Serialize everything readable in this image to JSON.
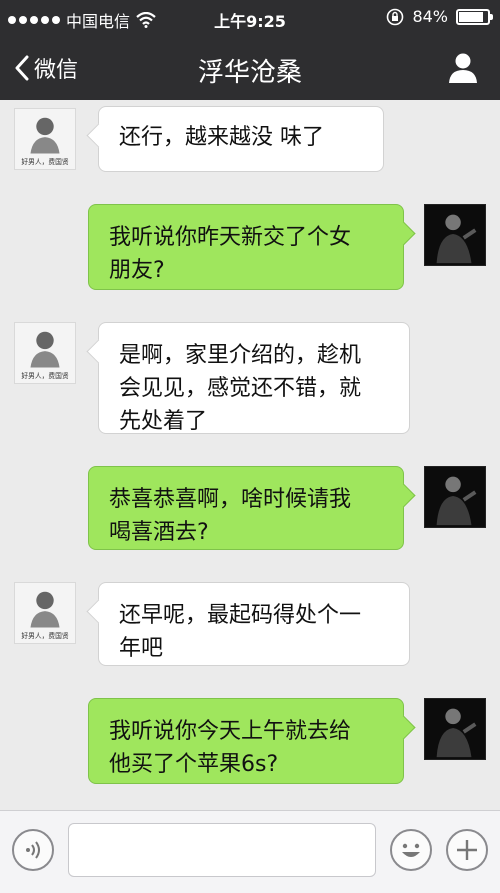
{
  "status_bar": {
    "carrier": "中国电信",
    "time": "上午9:25",
    "battery_text": "84%",
    "battery_level": 0.84
  },
  "nav": {
    "back_label": "微信",
    "title": "浮华沧桑"
  },
  "avatar_caption": "好男人，费国贤",
  "messages": [
    {
      "from": "friend",
      "lines": [
        "还行，越来越没 味了"
      ]
    },
    {
      "from": "me",
      "lines": [
        "我听说你昨天新交了个女",
        "朋友?"
      ]
    },
    {
      "from": "friend",
      "lines": [
        "是啊，家里介绍的，趁机",
        "会见见，感觉还不错，就",
        "先处着了"
      ]
    },
    {
      "from": "me",
      "lines": [
        "恭喜恭喜啊，啥时候请我",
        "喝喜酒去?"
      ]
    },
    {
      "from": "friend",
      "lines": [
        "还早呢，最起码得处个一",
        "年吧"
      ]
    },
    {
      "from": "me",
      "lines": [
        "我听说你今天上午就去给",
        "他买了个苹果6s?"
      ]
    }
  ],
  "icons": {
    "back": "chevron-left-icon",
    "profile": "person-icon",
    "voice": "voice-icon",
    "emoji": "smiley-icon",
    "add": "plus-icon",
    "signal": "signal-dots-icon",
    "wifi": "wifi-icon",
    "lock": "rotation-lock-icon",
    "battery": "battery-icon"
  },
  "colors": {
    "bar": "#2e2e30",
    "background": "#ebebeb",
    "my_bubble": "#9fe65d",
    "friend_bubble": "#ffffff"
  }
}
